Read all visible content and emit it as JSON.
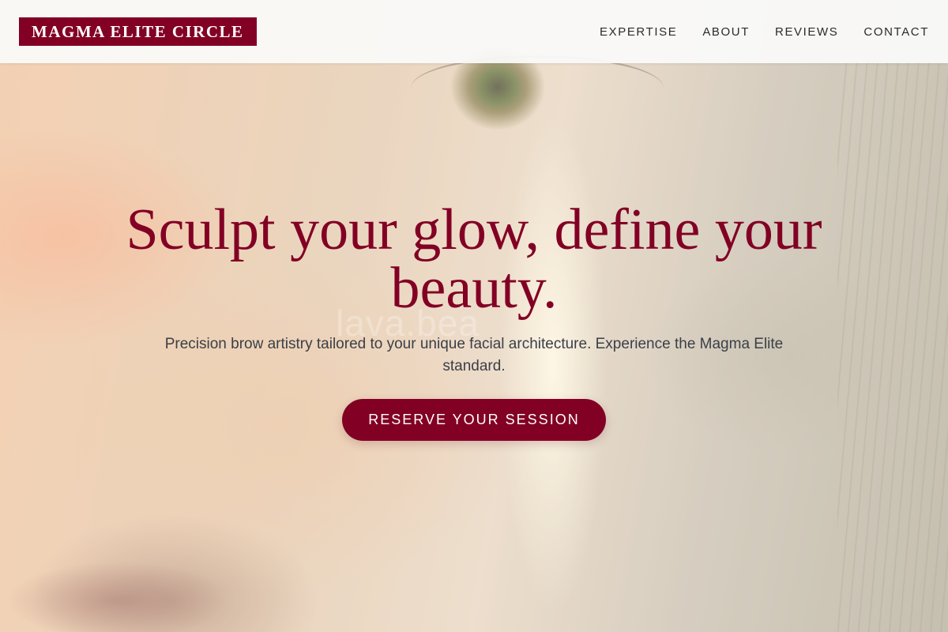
{
  "brand": {
    "name": "MAGMA ELITE CIRCLE",
    "color": "#820024"
  },
  "nav": {
    "items": [
      {
        "label": "EXPERTISE"
      },
      {
        "label": "ABOUT"
      },
      {
        "label": "REVIEWS"
      },
      {
        "label": "CONTACT"
      }
    ]
  },
  "hero": {
    "headline": "Sculpt your glow, define your beauty.",
    "subtext": "Precision brow artistry tailored to your unique facial architecture. Experience the Magma Elite standard.",
    "cta_label": "RESERVE YOUR SESSION",
    "watermark": "lava.bea"
  },
  "colors": {
    "accent": "#820024",
    "text_body": "#3a3f47",
    "nav_text": "#2b2b2b"
  }
}
